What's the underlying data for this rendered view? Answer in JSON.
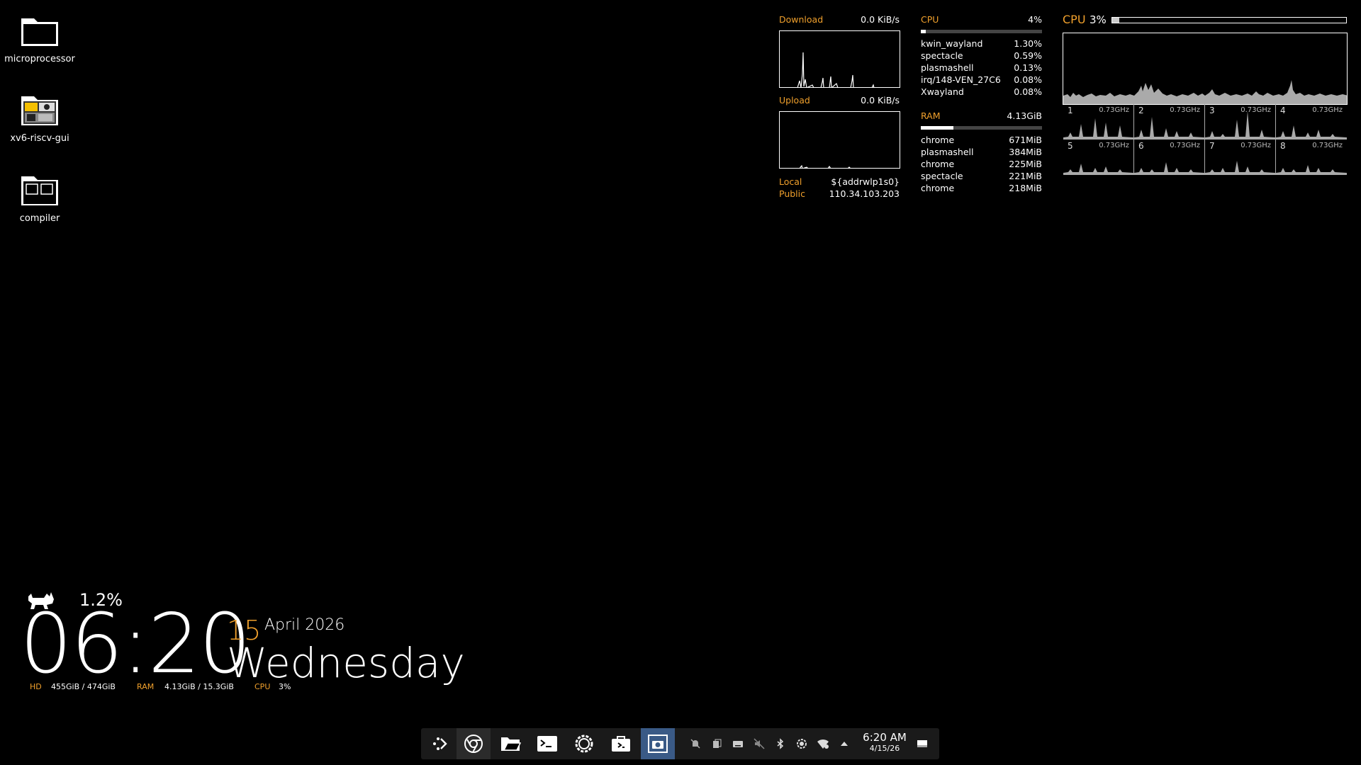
{
  "desktop_icons": [
    {
      "label": "microprocessor",
      "icon": "folder-icon"
    },
    {
      "label": "xv6-riscv-gui",
      "icon": "folder-thumbnail-icon"
    },
    {
      "label": "compiler",
      "icon": "folder-windows-icon"
    }
  ],
  "network": {
    "download_label": "Download",
    "download_value": "0.0 KiB/s",
    "upload_label": "Upload",
    "upload_value": "0.0 KiB/s",
    "local_label": "Local",
    "local_value": "${addrwlp1s0}",
    "public_label": "Public",
    "public_value": "110.34.103.203"
  },
  "cpu_processes": {
    "label": "CPU",
    "value": "4%",
    "usage_fraction": 0.04,
    "items": [
      {
        "name": "kwin_wayland",
        "value": "1.30%"
      },
      {
        "name": "spectacle",
        "value": "0.59%"
      },
      {
        "name": "plasmashell",
        "value": "0.13%"
      },
      {
        "name": "irq/148-VEN_27C6",
        "value": "0.08%"
      },
      {
        "name": "Xwayland",
        "value": "0.08%"
      }
    ]
  },
  "ram_processes": {
    "label": "RAM",
    "value": "4.13GiB",
    "usage_fraction": 0.27,
    "items": [
      {
        "name": "chrome",
        "value": "671MiB"
      },
      {
        "name": "plasmashell",
        "value": "384MiB"
      },
      {
        "name": "chrome",
        "value": "225MiB"
      },
      {
        "name": "spectacle",
        "value": "221MiB"
      },
      {
        "name": "chrome",
        "value": "218MiB"
      }
    ]
  },
  "cpu_cores": {
    "label": "CPU",
    "value": "3%",
    "usage_fraction": 0.03,
    "cores": [
      {
        "num": "1",
        "freq": "0.73GHz"
      },
      {
        "num": "2",
        "freq": "0.73GHz"
      },
      {
        "num": "3",
        "freq": "0.73GHz"
      },
      {
        "num": "4",
        "freq": "0.73GHz"
      },
      {
        "num": "5",
        "freq": "0.73GHz"
      },
      {
        "num": "6",
        "freq": "0.73GHz"
      },
      {
        "num": "7",
        "freq": "0.73GHz"
      },
      {
        "num": "8",
        "freq": "0.73GHz"
      }
    ]
  },
  "clock": {
    "cat_percent": "1.2%",
    "time": "06:20",
    "day": "15",
    "month_year": "April 2026",
    "weekday": "Wednesday",
    "hd_label": "HD",
    "hd_value": "455GiB / 474GiB",
    "ram_label": "RAM",
    "ram_value": "4.13GiB / 15.3GiB",
    "cpu_label": "CPU",
    "cpu_value": "3%"
  },
  "taskbar": {
    "apps": [
      {
        "icon": "app-launcher-icon"
      },
      {
        "icon": "chrome-icon"
      },
      {
        "icon": "file-manager-icon"
      },
      {
        "icon": "terminal-icon"
      },
      {
        "icon": "settings-icon"
      },
      {
        "icon": "store-icon"
      },
      {
        "icon": "screenshot-icon"
      }
    ],
    "tray_icons": [
      "notifications-off-icon",
      "clipboard-icon",
      "keyboard-icon",
      "volume-muted-icon",
      "bluetooth-icon",
      "brightness-icon",
      "wifi-icon",
      "chevron-up-icon"
    ],
    "time": "6:20 AM",
    "date": "4/15/26",
    "show_desktop_icon": "show-desktop-icon"
  },
  "colors": {
    "accent": "#f0a02c",
    "background": "#000000",
    "taskbar": "#1a1a1a",
    "focused": "#3a5a86"
  }
}
